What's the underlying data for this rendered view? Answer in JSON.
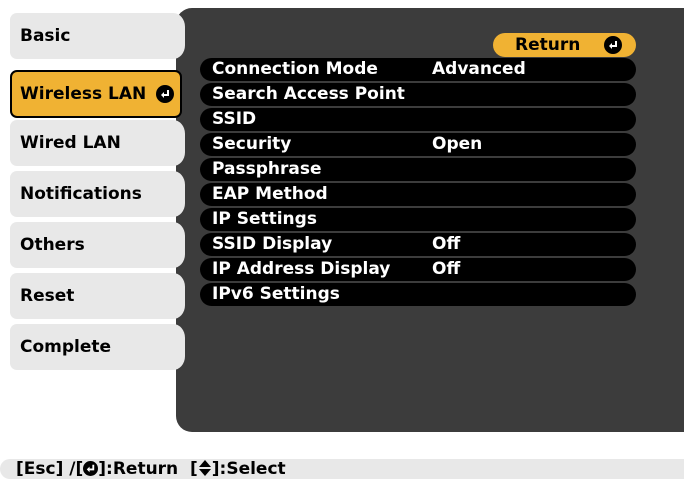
{
  "sidebar": {
    "items": [
      {
        "label": "Basic"
      },
      {
        "label": "Wireless LAN",
        "selected": true
      },
      {
        "label": "Wired LAN"
      },
      {
        "label": "Notifications"
      },
      {
        "label": "Others"
      },
      {
        "label": "Reset"
      },
      {
        "label": "Complete"
      }
    ]
  },
  "main": {
    "return_label": "Return",
    "rows": [
      {
        "label": "Connection Mode",
        "value": "Advanced"
      },
      {
        "label": "Search Access Point",
        "value": ""
      },
      {
        "label": "SSID",
        "value": ""
      },
      {
        "label": "Security",
        "value": "Open"
      },
      {
        "label": "Passphrase",
        "value": ""
      },
      {
        "label": "EAP Method",
        "value": ""
      },
      {
        "label": "IP Settings",
        "value": ""
      },
      {
        "label": "SSID Display",
        "value": "Off"
      },
      {
        "label": "IP Address Display",
        "value": "Off"
      },
      {
        "label": "IPv6 Settings",
        "value": ""
      }
    ]
  },
  "status": {
    "part1": "[Esc] /[",
    "part2": "]:Return  [",
    "part3": "]:Select"
  },
  "colors": {
    "accent": "#f0b233",
    "panel": "#3c3c3c",
    "tab": "#e8e8e8"
  },
  "icons": {
    "enter": "enter-icon",
    "updown": "up-down-arrow-icon"
  }
}
